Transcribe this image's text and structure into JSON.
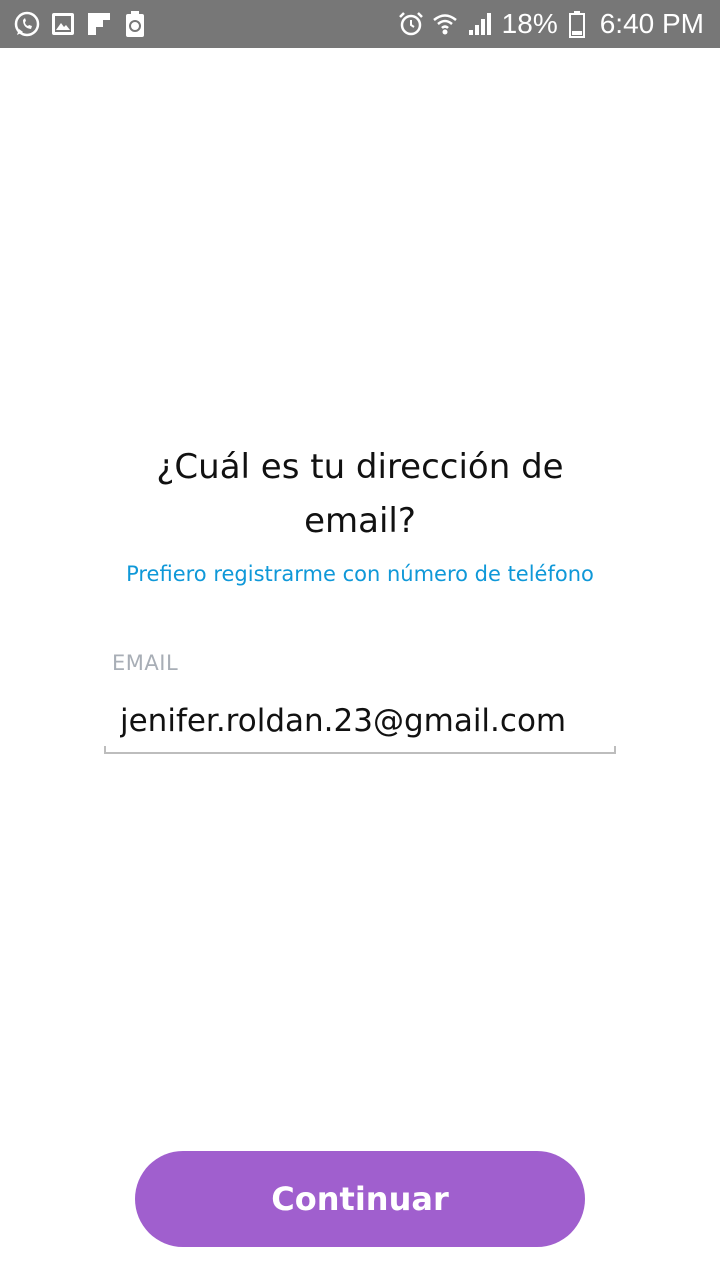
{
  "status_bar": {
    "left_icons": [
      "whatsapp-icon",
      "gallery-icon",
      "flipboard-icon",
      "recycle-battery-icon"
    ],
    "right_icons": [
      "alarm-icon",
      "wifi-icon",
      "signal-icon"
    ],
    "battery_percent": "18%",
    "battery_icon": "battery-icon",
    "time": "6:40 PM",
    "background_color": "#777777"
  },
  "signup": {
    "heading_line1": "¿Cuál es tu dirección de",
    "heading_line2": "email?",
    "phone_link": "Prefiero registrarme con número de teléfono",
    "email_label": "EMAIL",
    "email_value": "jenifer.roldan.23@gmail.com",
    "continue_label": "Continuar"
  },
  "colors": {
    "link": "#0f98d8",
    "button": "#a05fce",
    "label": "#a8aeb6"
  }
}
